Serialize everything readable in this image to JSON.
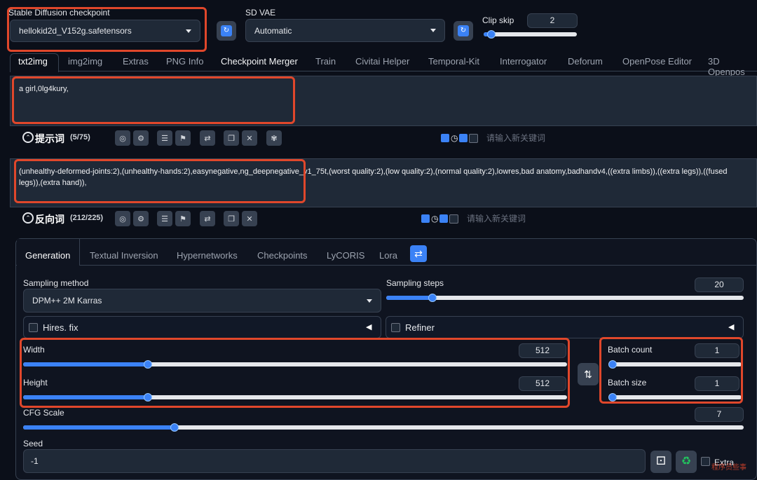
{
  "header": {
    "checkpoint_label": "Stable Diffusion checkpoint",
    "checkpoint_value": "hellokid2d_V152g.safetensors",
    "vae_label": "SD VAE",
    "vae_value": "Automatic",
    "clip_label": "Clip skip",
    "clip_value": "2",
    "clip_level": 0.08
  },
  "tabs": [
    {
      "label": "txt2img"
    },
    {
      "label": "img2img"
    },
    {
      "label": "Extras"
    },
    {
      "label": "PNG Info"
    },
    {
      "label": "Checkpoint Merger"
    },
    {
      "label": "Train"
    },
    {
      "label": "Civitai Helper"
    },
    {
      "label": "Temporal-Kit"
    },
    {
      "label": "Interrogator"
    },
    {
      "label": "Deforum"
    },
    {
      "label": "OpenPose Editor"
    },
    {
      "label": "3D Openpos"
    }
  ],
  "positive": {
    "text": "a girl,0lg4kury,",
    "label": "提示词",
    "count": "(5/75)",
    "keyword_placeholder": "请输入新关键词"
  },
  "negative": {
    "text": "(unhealthy-deformed-joints:2),(unhealthy-hands:2),easynegative,ng_deepnegative_v1_75t,(worst quality:2),(low quality:2),(normal quality:2),lowres,bad anatomy,badhandv4,((extra limbs)),((extra legs)),((fused legs)),(extra hand)),",
    "label": "反向词",
    "count": "(212/225)",
    "keyword_placeholder": "请输入新关键词"
  },
  "subtabs": [
    {
      "label": "Generation"
    },
    {
      "label": "Textual Inversion"
    },
    {
      "label": "Hypernetworks"
    },
    {
      "label": "Checkpoints"
    },
    {
      "label": "LyCORIS"
    },
    {
      "label": "Lora"
    }
  ],
  "generation": {
    "sampling_method_label": "Sampling method",
    "sampling_method_value": "DPM++ 2M Karras",
    "sampling_steps_label": "Sampling steps",
    "sampling_steps_value": "20",
    "sampling_steps_level": 0.13,
    "hires_label": "Hires. fix",
    "refiner_label": "Refiner",
    "width_label": "Width",
    "width_value": "512",
    "width_level": 0.23,
    "height_label": "Height",
    "height_value": "512",
    "height_level": 0.23,
    "batch_count_label": "Batch count",
    "batch_count_value": "1",
    "batch_size_label": "Batch size",
    "batch_size_value": "1",
    "cfg_label": "CFG Scale",
    "cfg_value": "7",
    "cfg_level": 0.21,
    "seed_label": "Seed",
    "seed_value": "-1",
    "extra_label": "Extra"
  },
  "watermark": "程序员些事",
  "colors": {
    "accent": "#3b82f6",
    "highlight": "#e0472b",
    "background": "#0b0f19"
  }
}
